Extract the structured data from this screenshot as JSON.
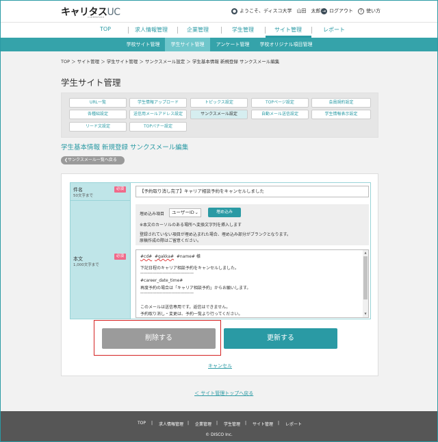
{
  "header": {
    "logo_main": "キャリタス",
    "logo_uc": "UC",
    "logo_sub": "CAREERTASU",
    "welcome": "ようこそ、ディスコ大学　山田　太郎様",
    "logout": "ログアウト",
    "help": "使い方"
  },
  "nav_primary": [
    "TOP",
    "求人情報管理",
    "企業管理",
    "学生管理",
    "サイト管理",
    "レポート"
  ],
  "nav_secondary": [
    "学校サイト管理",
    "学生サイト管理",
    "アンケート管理",
    "学校オリジナル項目管理"
  ],
  "breadcrumb": "TOP ＞ サイト管理 ＞ 学生サイト管理 ＞ サンクスメール設定 ＞ 学生基本情報 新規登録 サンクスメール編集",
  "page_title": "学生サイト管理",
  "menu": [
    "URL一覧",
    "学生情報アップロード",
    "トピックス設定",
    "TOPページ設定",
    "会員規約設定",
    "各種紹設定",
    "送信用メールアドレス設定",
    "サンクスメール設定",
    "自動メール送信設定",
    "学生情報表示設定",
    "リード文設定",
    "TOPバナー設定"
  ],
  "section_title": "学生基本情報 新規登録 サンクスメール編集",
  "back_button": "サンクスメール一覧へ戻る",
  "form": {
    "subject_label": "件名",
    "subject_limit": "50文字まで",
    "required": "必須",
    "subject_value": "【予約取り消し完了】キャリア相談予約をキャンセルしました",
    "body_label": "本文",
    "body_limit": "1,000文字まで",
    "embed_label": "埋め込み項目",
    "embed_selected": "ユーザーID",
    "embed_button": "埋め込み",
    "embed_note1": "※本文のカーソルのある場所へ変換文字列を挿入します",
    "embed_note2": "登録されていない項目が埋め込まれた場合、埋め込み部分がブランクとなります。",
    "embed_note3": "原稿作成の際はご留意ください。",
    "body_line1_a": "#cd#",
    "body_line1_b": "#gakka#",
    "body_line1_c": "#name# 様",
    "body_line2": "下記日程のキャリア相談予約をキャンセルしました。",
    "body_line3": "------------------------------------",
    "body_line4": "#career_date_time#",
    "body_line5": "再度予約の場合は「キャリア相談予約」からお願いします。",
    "body_line6": "------------------------------------",
    "body_line7": "このメールは送信専用です。返信はできません。",
    "body_line8": "予約取り消し・変更は、予約一覧より行ってください。"
  },
  "buttons": {
    "delete": "削除する",
    "update": "更新する",
    "cancel": "キャンセル"
  },
  "top_link": "＜ サイト管理トップへ戻る",
  "footer": {
    "links": [
      "TOP",
      "求人情報管理",
      "企業管理",
      "学生管理",
      "サイト管理",
      "レポート"
    ],
    "copyright": "© DISCO Inc."
  }
}
